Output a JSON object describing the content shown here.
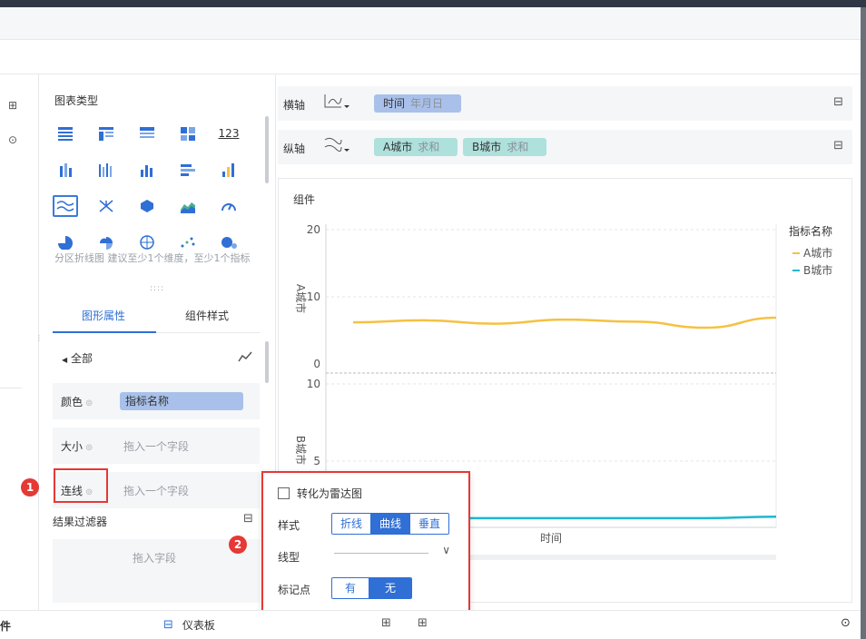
{
  "left_panel": {
    "chart_type_title": "图表类型",
    "chart_type_icons": [
      "table-icon",
      "cross-table-icon",
      "detail-table-icon",
      "kpi-icon",
      "number-icon",
      "dot-bar-icon",
      "multi-bar-icon",
      "column-icon",
      "bar-icon",
      "step-column-icon",
      "area-line-icon",
      "radar-icon",
      "polygon-icon",
      "area-icon",
      "gauge-icon",
      "pie-icon",
      "rose-icon",
      "globe-icon",
      "scatter-icon",
      "bubble-icon"
    ],
    "number_icon_text": "123",
    "hint": "分区折线图 建议至少1个维度，至少1个指标",
    "drag_dots": "::::",
    "tabs": [
      "图形属性",
      "组件样式"
    ],
    "group_all": "全部",
    "rows": {
      "color_label": "颜色",
      "color_field": "指标名称",
      "size_label": "大小",
      "size_placeholder": "拖入一个字段",
      "line_label": "连线",
      "line_placeholder": "拖入一个字段"
    },
    "filter_title": "结果过滤器",
    "filter_placeholder": "拖入字段"
  },
  "axes": {
    "x_label": "横轴",
    "x_field": "时间",
    "x_field_sub": "年月日",
    "y_label": "纵轴",
    "y_field_a": "A城市",
    "y_field_a_sub": "求和",
    "y_field_b": "B城市",
    "y_field_b_sub": "求和"
  },
  "chart_title": "组件",
  "chart_data": {
    "type": "line",
    "xlabel": "时间",
    "legend_title": "指标名称",
    "legend_position": "top-right",
    "panels": [
      {
        "ylabel": "A城市",
        "ylim": [
          0,
          20
        ],
        "yticks": [
          "20",
          "10",
          "0"
        ]
      },
      {
        "ylabel": "B城市",
        "ylim": [
          0,
          10
        ],
        "yticks": [
          "10",
          "5"
        ]
      }
    ],
    "series": [
      {
        "name": "A城市",
        "color": "#f6c142",
        "panel": 0,
        "values": [
          6.2,
          6.5,
          6.0,
          6.6,
          6.3,
          5.4,
          6.9
        ]
      },
      {
        "name": "B城市",
        "color": "#1cb8cf",
        "panel": 1,
        "values": [
          1.3,
          1.3,
          1.3,
          1.3,
          1.3,
          1.3,
          1.4
        ]
      }
    ]
  },
  "popup": {
    "radar_checkbox": "转化为雷达图",
    "style_label": "样式",
    "style_options": [
      "折线",
      "曲线",
      "垂直"
    ],
    "style_selected": "曲线",
    "line_type_label": "线型",
    "marker_label": "标记点",
    "marker_options": [
      "有",
      "无"
    ],
    "marker_selected": "无"
  },
  "bottom": {
    "left_tab": "件",
    "dashboard": "仪表板"
  },
  "annotations": {
    "badge1": "1",
    "badge2": "2"
  },
  "colors": {
    "accent": "#2f6fd6",
    "highlight": "#e53935"
  }
}
